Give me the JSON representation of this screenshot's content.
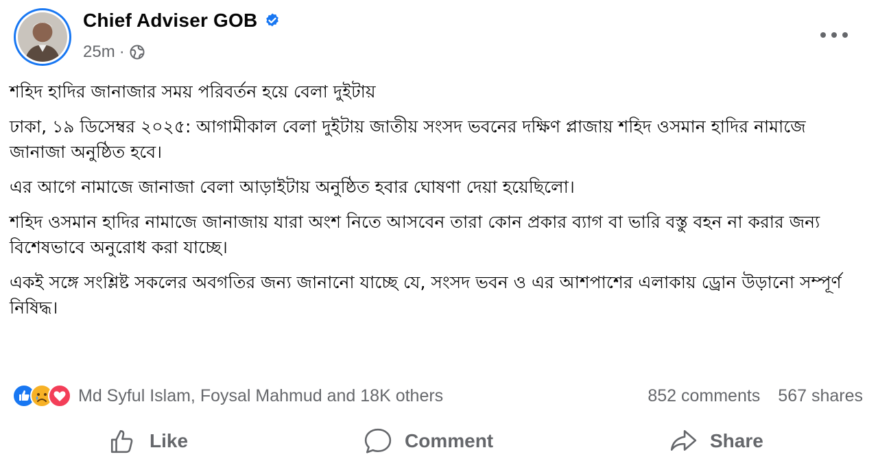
{
  "post": {
    "page_name": "Chief Adviser GOB",
    "timestamp": "25m",
    "separator": "·",
    "verified_icon": "verified-badge-icon",
    "audience_icon": "globe-icon",
    "more_icon": "more-horizontal-icon",
    "avatar_icon": "profile-photo-avatar",
    "paragraphs": {
      "headline": "শহিদ হাদির জানাজার সময় পরিবর্তন হয়ে বেলা দুইটায়",
      "p1": "ঢাকা, ১৯ ডিসেম্বর ২০২৫: আগামীকাল বেলা দুইটায় জাতীয় সংসদ ভবনের দক্ষিণ প্লাজায় শহিদ ওসমান হাদির নামাজে জানাজা অনুষ্ঠিত হবে।",
      "p2": "এর আগে নামাজে জানাজা বেলা আড়াইটায় অনুষ্ঠিত হবার ঘোষণা দেয়া হয়েছিলো।",
      "p3": "শহিদ ওসমান হাদির নামাজে জানাজায় যারা অংশ নিতে আসবেন তারা কোন প্রকার ব্যাগ বা ভারি বস্তু বহন না করার জন্য বিশেষভাবে অনুরোধ করা যাচ্ছে।",
      "p4": "একই সঙ্গে সংশ্লিষ্ট সকলের অবগতির জন্য জানানো যাচ্ছে যে, সংসদ ভবন ও এর আশপাশের এলাকায় ড্রোন উড়ানো সম্পূর্ণ নিষিদ্ধ।"
    }
  },
  "stats": {
    "reaction_icons": [
      "like-reaction-icon",
      "sad-reaction-icon",
      "love-reaction-icon"
    ],
    "reactors": "Md Syful Islam, Foysal Mahmud and 18K others",
    "comments": "852 comments",
    "shares": "567 shares"
  },
  "actions": {
    "like_label": "Like",
    "comment_label": "Comment",
    "share_label": "Share",
    "like_icon": "thumbs-up-icon",
    "comment_icon": "speech-bubble-icon",
    "share_icon": "share-arrow-icon"
  },
  "colors": {
    "accent": "#1877f2",
    "secondary_text": "#65676b",
    "primary_text": "#050505",
    "love": "#f33e58",
    "sad": "#f7b125"
  }
}
